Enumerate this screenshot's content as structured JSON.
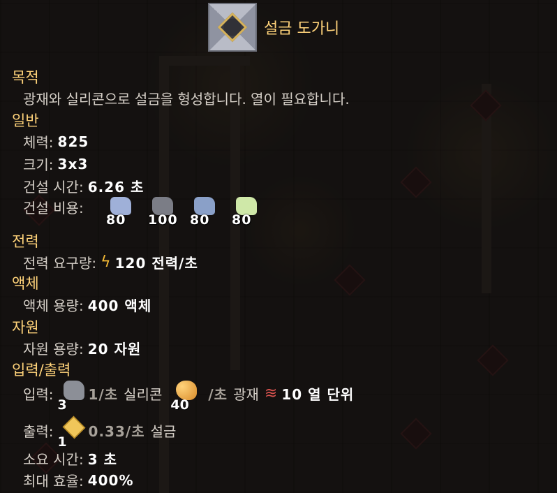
{
  "title": "설금 도가니",
  "sections": {
    "purpose": {
      "header": "목적",
      "text": "광재와 실리콘으로 설금을 형성합니다. 열이 필요합니다."
    },
    "general": {
      "header": "일반",
      "health_label": "체력:",
      "health": "825",
      "size_label": "크기:",
      "size": "3x3",
      "build_time_label": "건설 시간:",
      "build_time": "6.26 초",
      "build_cost_label": "건설 비용:",
      "build_cost": [
        {
          "amount": "80",
          "color": "#9fb0d8"
        },
        {
          "amount": "100",
          "color": "#7b7d86"
        },
        {
          "amount": "80",
          "color": "#8aa0c8"
        },
        {
          "amount": "80",
          "color": "#cfe8a8"
        }
      ]
    },
    "power": {
      "header": "전력",
      "usage_label": "전력 요구량:",
      "usage": "120 전력/초"
    },
    "liquid": {
      "header": "액체",
      "capacity_label": "액체 용량:",
      "capacity": "400 액체"
    },
    "resources": {
      "header": "자원",
      "capacity_label": "자원 용량:",
      "capacity": "20 자원"
    },
    "io": {
      "header": "입력/출력",
      "input_label": "입력:",
      "inputs": [
        {
          "count": "3",
          "rate": "1/초",
          "name": "실리콘",
          "icon": "silicon-icon"
        },
        {
          "count": "40",
          "rate": "/초",
          "name": "광재",
          "icon": "slag-icon"
        }
      ],
      "heat": "10 열 단위",
      "output_label": "출력:",
      "output": {
        "count": "1",
        "rate": "0.33/초",
        "name": "설금",
        "icon": "phase-fabric-icon"
      },
      "craft_time_label": "소요 시간:",
      "craft_time": "3 초",
      "max_eff_label": "최대 효율:",
      "max_eff": "400%"
    }
  }
}
